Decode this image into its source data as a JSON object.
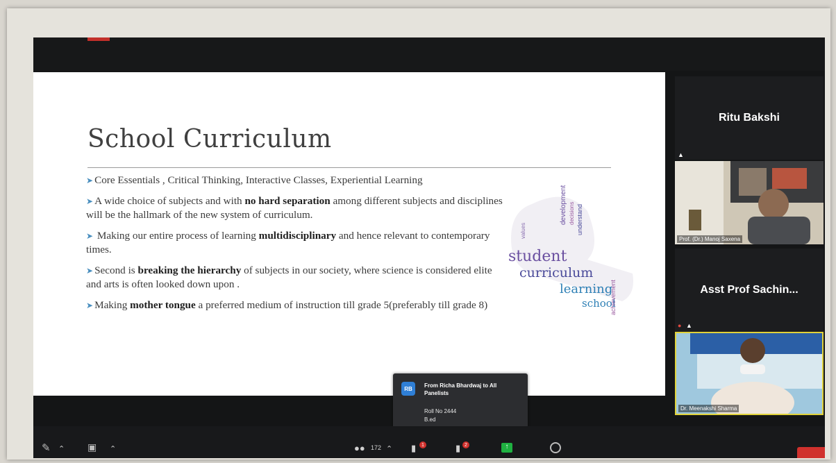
{
  "slide": {
    "title": "School Curriculum",
    "bullets": [
      {
        "pre": "Core Essentials , Critical Thinking, Interactive Classes, Experiential Learning",
        "bold": "",
        "post": ""
      },
      {
        "pre": "A wide choice of subjects and with ",
        "bold": "no hard separation",
        "post": " among different subjects and disciplines will be the hallmark of the new system of curriculum."
      },
      {
        "pre": " Making our entire process of learning ",
        "bold": "multidisciplinary",
        "post": " and hence relevant to contemporary times."
      },
      {
        "pre": "Second is ",
        "bold": "breaking the hierarchy",
        "post": " of subjects in our society, where science is considered elite and arts is often looked down upon ."
      },
      {
        "pre": "Making ",
        "bold": "mother tongue",
        "post": " a preferred medium of instruction till grade 5(preferably till grade 8)"
      }
    ],
    "wordcloud": {
      "words": [
        "student",
        "curriculum",
        "learning",
        "school",
        "development",
        "understand",
        "decisions",
        "values",
        "achievement"
      ],
      "colors": [
        "#6a4fa0",
        "#4a4a9a",
        "#2d7fb5",
        "#5b8f3a",
        "#9a5aa0"
      ]
    }
  },
  "participants": [
    {
      "name": "Ritu Bakshi",
      "video": false
    },
    {
      "name": "Prof. (Dr.) Manoj Saxena",
      "video": true
    },
    {
      "name": "Asst Prof Sachin...",
      "video": false
    },
    {
      "name": "Dr. Meenakshi Sharma",
      "video": true
    }
  ],
  "chat_popup": {
    "avatar": "RB",
    "from": "From Richa Bhardwaj to All Panelists",
    "line1": "Roll No 2444",
    "line2": "B.ed"
  },
  "toolbar": {
    "participants_count": "172",
    "chat_badge_1": "1",
    "chat_badge_2": "2"
  },
  "colors": {
    "accent_blue": "#2f7fd6",
    "alert_red": "#d0312d",
    "share_green": "#1fb141"
  }
}
